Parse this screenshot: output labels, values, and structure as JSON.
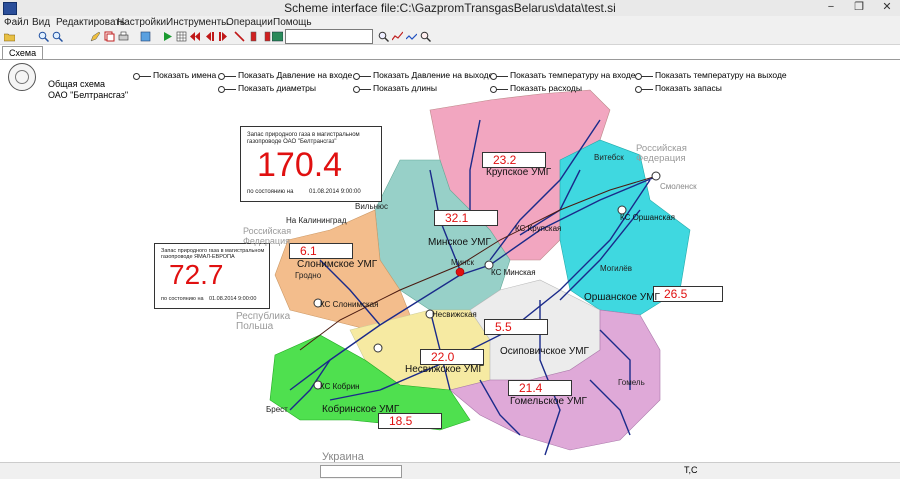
{
  "window": {
    "title": "Scheme interface file:C:\\GazpromTransgasBelarus\\data\\test.si",
    "minimize": "−",
    "restore": "❐",
    "close": "✕"
  },
  "menu": [
    "Файл",
    "Вид",
    "Редактировать",
    "Настройки",
    "Инструменты",
    "Операции",
    "Помощь"
  ],
  "tabs": [
    "Схема"
  ],
  "legend": {
    "title_line1": "Общая схема",
    "title_line2": "ОАО \"Белтрансгаз\"",
    "toggles": [
      "Показать имена",
      "Показать Давление на входе",
      "Показать Давление на выходе",
      "Показать температуру на входе",
      "Показать температуру на выходе",
      "Показать диаметры",
      "Показать длины",
      "Показать расходы",
      "Показать запасы"
    ]
  },
  "info_main": {
    "caption_line1": "Запас природного газа в магистральном",
    "caption_line2": "газопроводе ОАО \"Белтрансгаз\"",
    "value": "170.4",
    "as_of_label": "по состоянию на",
    "as_of_date": "01.08.2014 9:00:00"
  },
  "info_yamal": {
    "caption_line1": "Запас природного газа в магистральном",
    "caption_line2": "газопроводе ЯМАЛ-ЕВРОПА",
    "value": "72.7",
    "as_of_label": "по состоянию на",
    "as_of_date": "01.08.2014 9:00:00"
  },
  "regions": [
    {
      "key": "krupskoe",
      "value": "23.2",
      "name": "Крупское УМГ",
      "color": "#f2a6c0"
    },
    {
      "key": "minskoe",
      "value": "32.1",
      "name": "Минское УМГ",
      "color": "#97d0c8"
    },
    {
      "key": "slonimskoe",
      "value": "6.1",
      "name": "Слонимское УМГ",
      "color": "#f3bd8c"
    },
    {
      "key": "orshanskoe",
      "value": "26.5",
      "name": "Оршанское УМГ",
      "color": "#3fd8e0"
    },
    {
      "key": "nesvizhskoe",
      "value": "22.0",
      "name": "Несвижское УМГ",
      "color": "#f6eaa2"
    },
    {
      "key": "osipovichskoe",
      "value": "5.5",
      "name": "Осиповичское УМГ",
      "color": "#ececec"
    },
    {
      "key": "gomelskoe",
      "value": "21.4",
      "name": "Гомельское УМГ",
      "color": "#dfa9d8"
    },
    {
      "key": "kobrinskoe",
      "value": "18.5",
      "name": "Кобринское УМГ",
      "color": "#4fe04f"
    }
  ],
  "geo": {
    "russia_east": "Российская\nФедерация",
    "russia_west": "Российская\nФедерация",
    "to_kaliningrad": "На Калининград",
    "poland": "Республика\nПольша",
    "ukraine": "Украина"
  },
  "cities": {
    "minsk": "Минск",
    "grodno": "Гродно",
    "brest": "Брест",
    "vitebsk": "Витебск",
    "mogilev": "Могилёв",
    "gomel": "Гомель",
    "smolensk": "Смоленск",
    "vilnius": "Вильнюс"
  },
  "stations": {
    "krupskaya": "КС Крупская",
    "minskaya": "КС Минская",
    "orshanskaya": "КС Оршанская",
    "slonimskaya": "КС Слонимская",
    "nesvizhskaya": "Несвижская",
    "kobrinskaya": "КС Кобрин",
    "osipovichskaya": "Осиповичская"
  },
  "statusbar": {
    "text": "Т,С"
  }
}
